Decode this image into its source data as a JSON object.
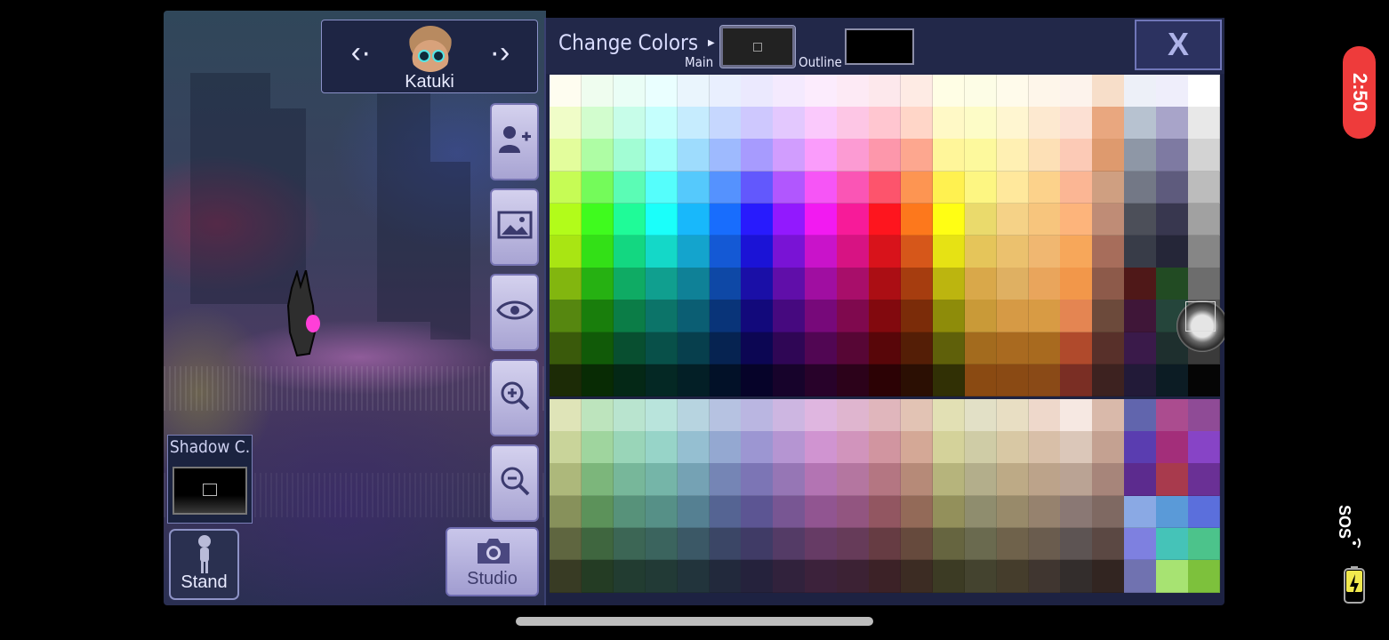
{
  "character": {
    "name": "Katuki"
  },
  "left_panel": {
    "shadow_label": "Shadow C.",
    "stand_label": "Stand",
    "studio_label": "Studio"
  },
  "color_panel": {
    "title": "Change Colors",
    "main_label": "Main",
    "outline_label": "Outline",
    "close_label": "X",
    "main_color": "#222222",
    "outline_color": "#000000"
  },
  "palette": {
    "top_rows": [
      [
        "#fefdf0",
        "#effdef",
        "#eafef6",
        "#eaffff",
        "#eaf5fd",
        "#e9effe",
        "#ebe9fe",
        "#f4eafe",
        "#fcecfd",
        "#fdeaf5",
        "#fde8ec",
        "#feebe4",
        "#fffee5",
        "#fdfde6",
        "#fffbeb",
        "#fef6ea",
        "#fdf3ec",
        "#f7dec9",
        "#edf0f8",
        "#efeefb",
        "#ffffff"
      ],
      [
        "#f0fdc8",
        "#d2fdce",
        "#c7fde9",
        "#c5fffd",
        "#c6ecfe",
        "#c6d7fe",
        "#cec8fe",
        "#e3c8fe",
        "#fac9fc",
        "#fdc6e5",
        "#ffc6d0",
        "#ffd6c8",
        "#fff9c6",
        "#fdfcc7",
        "#fff6d1",
        "#fde9d0",
        "#fce0d3",
        "#e9a77f",
        "#b7c2d0",
        "#a8a4c9",
        "#e8e8e8"
      ],
      [
        "#e3fd9c",
        "#aefda4",
        "#a2fdd4",
        "#9ffffb",
        "#9edcfd",
        "#9ebafe",
        "#a79bfe",
        "#d19dfe",
        "#fa9cfb",
        "#fc9bd3",
        "#fd97ab",
        "#fda78f",
        "#fff69a",
        "#fdf99d",
        "#fff0b3",
        "#fde0b6",
        "#fccab6",
        "#de9a6e",
        "#8e97a6",
        "#7e7aa2",
        "#d3d3d3"
      ],
      [
        "#c6fc55",
        "#74fb5a",
        "#5bfcb5",
        "#55fefc",
        "#55c9fc",
        "#5592fe",
        "#6258fd",
        "#b157fe",
        "#f655f6",
        "#fa55b5",
        "#fd546c",
        "#fd9552",
        "#fff150",
        "#fdf682",
        "#ffe89c",
        "#fcd28b",
        "#fbb694",
        "#cf9f81",
        "#737886",
        "#5e5b7d",
        "#bcbcbc"
      ],
      [
        "#b2fc1a",
        "#3ffb1e",
        "#1ffb98",
        "#1afffa",
        "#18b8fb",
        "#186dfd",
        "#281bfd",
        "#9219fe",
        "#f21af1",
        "#f71b99",
        "#fe151e",
        "#fd781c",
        "#fffe14",
        "#eada6c",
        "#f5d287",
        "#f7c57d",
        "#fdb47b",
        "#bf8c76",
        "#4c4f59",
        "#38374f",
        "#a1a1a1"
      ],
      [
        "#a9e513",
        "#33e017",
        "#13d781",
        "#14d8c8",
        "#14a4cd",
        "#1459d5",
        "#1b13d6",
        "#7913d5",
        "#c913ca",
        "#d71383",
        "#d8131b",
        "#d6571a",
        "#e6e214",
        "#e5c55a",
        "#ebc16e",
        "#f0b771",
        "#f7a75a",
        "#a76d5b",
        "#383c48",
        "#252638",
        "#868686"
      ],
      [
        "#82b60f",
        "#26b112",
        "#0fab64",
        "#109f8f",
        "#0f8197",
        "#0e48a6",
        "#1a0fa7",
        "#600ea9",
        "#a00ea1",
        "#a80e6a",
        "#ab0e14",
        "#a63d0f",
        "#bcb50f",
        "#d9a84a",
        "#dfb062",
        "#e9a55c",
        "#f2974a",
        "#8d5a4a",
        "#4f1818",
        "#224b23",
        "#6d6d6d"
      ],
      [
        "#568710",
        "#197e0c",
        "#0b7d47",
        "#0c7469",
        "#0b5e73",
        "#093479",
        "#12097b",
        "#46097f",
        "#77097a",
        "#7f094e",
        "#82090e",
        "#7b2c09",
        "#8e8c0a",
        "#c99a38",
        "#d69a45",
        "#d89b44",
        "#e48552",
        "#6c4a3b",
        "#3f1638",
        "#25453b",
        "#525252"
      ],
      [
        "#3a5a0b",
        "#115a08",
        "#084f30",
        "#085049",
        "#073f4d",
        "#062351",
        "#0c0653",
        "#2f0655",
        "#510653",
        "#570635",
        "#580609",
        "#541e06",
        "#5f600a",
        "#a36b1e",
        "#a96a20",
        "#a86a1f",
        "#b04a2c",
        "#58302a",
        "#3a1a4a",
        "#1e2f2e",
        "#3a3a3a"
      ],
      [
        "#1c2b06",
        "#082b04",
        "#042816",
        "#042824",
        "#031f26",
        "#021128",
        "#060329",
        "#17032b",
        "#28022a",
        "#2c021a",
        "#2c0205",
        "#2b0f03",
        "#313005",
        "#8a4a12",
        "#8a4a14",
        "#8a4a17",
        "#7a2e24",
        "#3d2220",
        "#221a38",
        "#0c1c24",
        "#050505"
      ]
    ],
    "bottom_rows": [
      [
        "#dfe4b8",
        "#bde4bd",
        "#b9e4cf",
        "#b9e4dc",
        "#b7d4e0",
        "#b6c2e1",
        "#bab6e1",
        "#cdb6e1",
        "#dfb6e0",
        "#dfb5cf",
        "#e0b6bc",
        "#e2c3b4",
        "#e2e0b4",
        "#e2e0c6",
        "#e8dec3",
        "#eed8cb",
        "#f6e8e2",
        "#d9b9aa",
        "#6165ad",
        "#ab4c8f",
        "#8f4b96"
      ],
      [
        "#c9d49a",
        "#9fd59e",
        "#99d5b8",
        "#97d4c8",
        "#95bfd1",
        "#94a8d1",
        "#9c96d2",
        "#b595d2",
        "#d094d1",
        "#d194bc",
        "#d195a0",
        "#d4a896",
        "#d4d29a",
        "#cfcca6",
        "#d8c8a4",
        "#d8bfa8",
        "#dbc7b9",
        "#c4a191",
        "#5a3db0",
        "#a32e7a",
        "#8744c6"
      ],
      [
        "#adb87b",
        "#7cb67b",
        "#77b79a",
        "#75b5a8",
        "#75a2b4",
        "#7585b5",
        "#7c75b5",
        "#9676b5",
        "#b374b3",
        "#b476a0",
        "#b47682",
        "#b68a78",
        "#b6b47c",
        "#b3ae8b",
        "#bdaa86",
        "#bca38a",
        "#baa394",
        "#a7857a",
        "#5c2b8e",
        "#a83a4d",
        "#6a3095"
      ],
      [
        "#87915b",
        "#5c925a",
        "#57927a",
        "#569087",
        "#558092",
        "#556493",
        "#5c5593",
        "#785693",
        "#915591",
        "#925580",
        "#925661",
        "#936a58",
        "#93905b",
        "#8f8d6e",
        "#988a6a",
        "#96826e",
        "#8a7874",
        "#7f6962",
        "#8aa9e4",
        "#5a9ad8",
        "#5b6fdc"
      ],
      [
        "#5f6640",
        "#3f663f",
        "#3c6655",
        "#3b645e",
        "#3b5866",
        "#3b4666",
        "#403b66",
        "#543b66",
        "#663b65",
        "#663b59",
        "#663c43",
        "#664a3d",
        "#666540",
        "#6a6a4f",
        "#6f624b",
        "#6a5c4e",
        "#5d5453",
        "#5b4843",
        "#7e80e0",
        "#45c3b8",
        "#4cc38b"
      ],
      [
        "#383b24",
        "#243c24",
        "#223c31",
        "#223a36",
        "#22343c",
        "#22293c",
        "#25223c",
        "#31223c",
        "#3c223b",
        "#3c2234",
        "#3c2227",
        "#3c2c23",
        "#3c3b24",
        "#44432f",
        "#453d2c",
        "#403630",
        "#332d2c",
        "#322521",
        "#7072b0",
        "#a7e372",
        "#7dc13c"
      ]
    ]
  }
}
